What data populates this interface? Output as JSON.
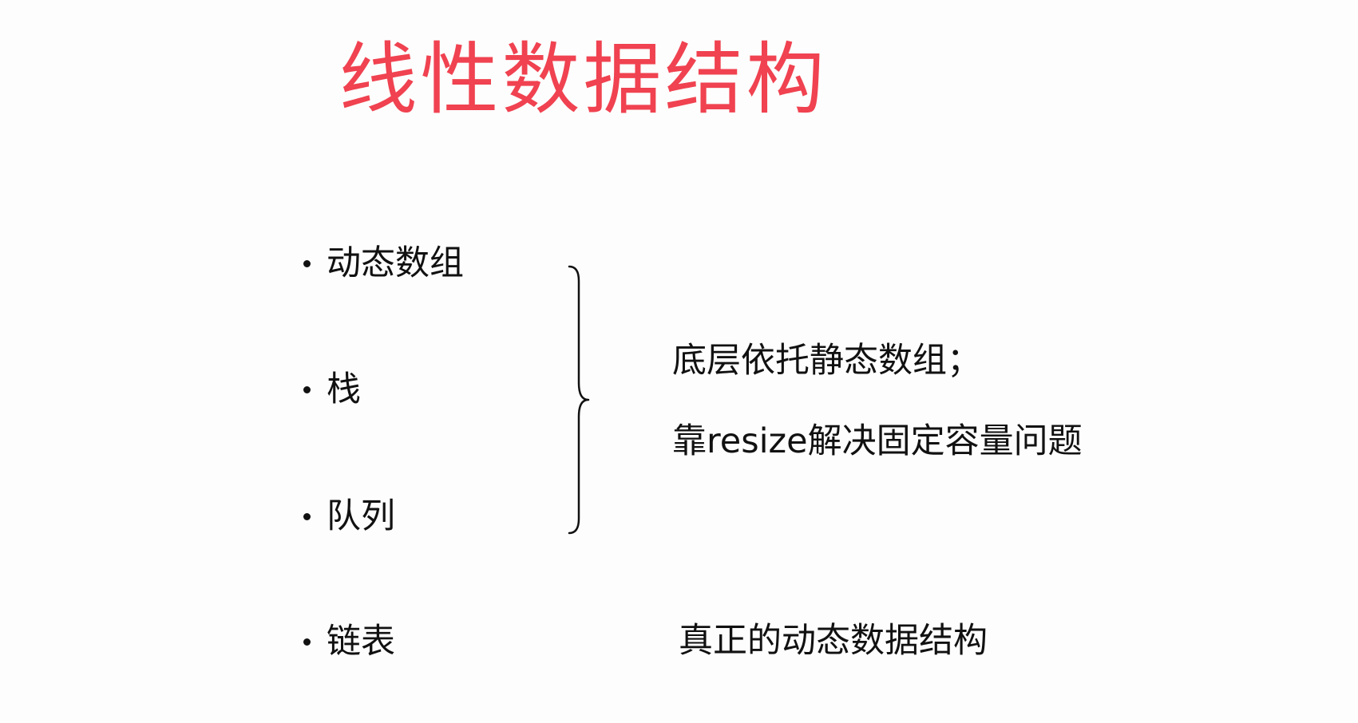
{
  "slide": {
    "title": "线性数据结构",
    "title_color": "#f04250",
    "bullets": [
      {
        "label": "动态数组"
      },
      {
        "label": "栈"
      },
      {
        "label": "队列"
      },
      {
        "label": "链表"
      }
    ],
    "group_note": {
      "line1": "底层依托静态数组；",
      "line2": "靠resize解决固定容量问题"
    },
    "linked_list_note": "真正的动态数据结构"
  }
}
